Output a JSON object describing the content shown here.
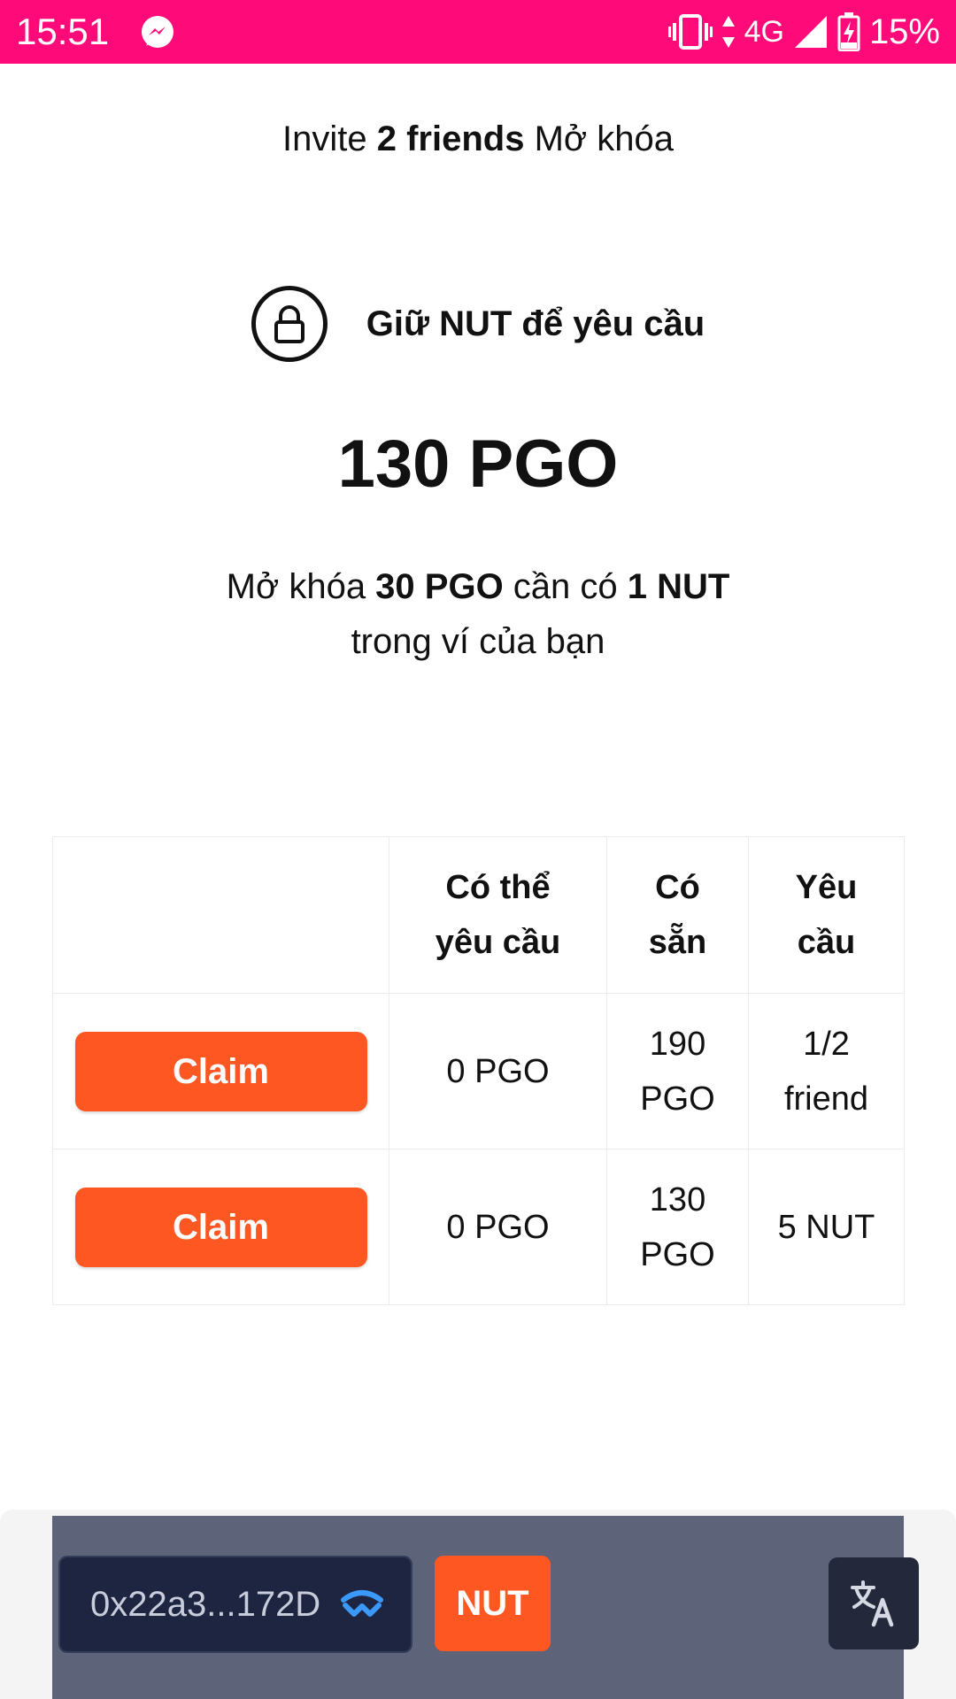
{
  "status_bar": {
    "time": "15:51",
    "network": "4G",
    "battery_percent": "15%",
    "background_color": "#ff0a78",
    "icons": [
      "messenger-icon",
      "vibrate-icon",
      "data-arrows-icon",
      "signal-icon",
      "battery-charging-icon"
    ]
  },
  "invite": {
    "prefix": "Invite ",
    "friends": "2 friends",
    "suffix": " Mở khóa"
  },
  "lock_section": {
    "icon": "lock-icon",
    "title": "Giữ NUT để yêu cầu"
  },
  "amount": "130 PGO",
  "unlock_text": {
    "prefix": "Mở khóa ",
    "amount": "30 PGO",
    "middle": " cần có ",
    "requirement": "1 NUT",
    "line2": "trong ví của bạn"
  },
  "table": {
    "headers": {
      "claimable": [
        "Có thể",
        "yêu cầu"
      ],
      "available": [
        "Có",
        "sẵn"
      ],
      "requirement": [
        "Yêu",
        "cầu"
      ]
    },
    "rows": [
      {
        "button": "Claim",
        "claimable": "0 PGO",
        "available": [
          "190",
          "PGO"
        ],
        "requirement": [
          "1/2",
          "friend"
        ]
      },
      {
        "button": "Claim",
        "claimable": "0 PGO",
        "available": [
          "130",
          "PGO"
        ],
        "requirement": [
          "5 NUT"
        ]
      }
    ]
  },
  "bottom_bar": {
    "wallet_address": "0x22a3...172D",
    "wallet_icon": "walletconnect-icon",
    "token_button": "NUT",
    "translate_icon": "translate-icon"
  },
  "colors": {
    "accent": "#ff5722",
    "bar_background": "#5d6378",
    "wallet_background": "#1e2540"
  }
}
